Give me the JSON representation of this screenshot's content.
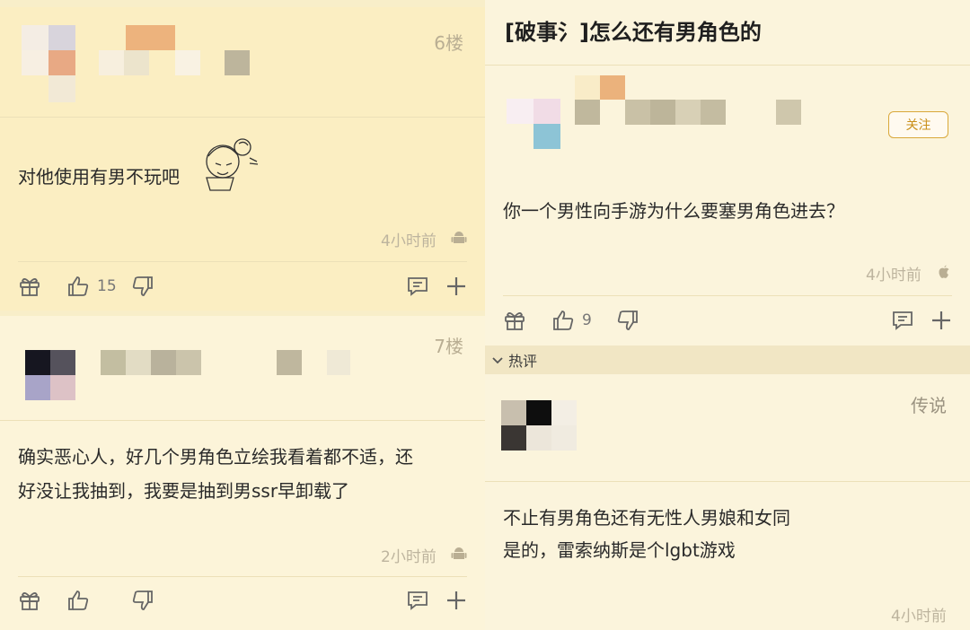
{
  "left": {
    "post1": {
      "floor": "6楼",
      "content": "对他使用有男不玩吧",
      "time": "4小时前",
      "os_icon": "android-icon",
      "like_count": "15"
    },
    "post2": {
      "floor": "7楼",
      "content_line1": "确实恶心人，好几个男角色立绘我看着都不适，还",
      "content_line2": "好没让我抽到，我要是抽到男ssr早卸载了",
      "time": "2小时前",
      "os_icon": "android-icon",
      "like_count": ""
    }
  },
  "right": {
    "title": "[破事氵]怎么还有男角色的",
    "follow_label": "关注",
    "op": {
      "content": "你一个男性向手游为什么要塞男角色进去？",
      "time": "4小时前",
      "os_icon": "apple-icon",
      "like_count": "9"
    },
    "hot_label": "热评",
    "hot_comment": {
      "badge": "传说",
      "line1": "不止有男角色还有无性人男娘和女同",
      "line2": "是的，雷索纳斯是个lgbt游戏",
      "time": "4小时前"
    }
  },
  "colors": {
    "accent": "#d9a83a",
    "card_bg": "#fbeec2",
    "muted_text": "#bdb49e"
  }
}
